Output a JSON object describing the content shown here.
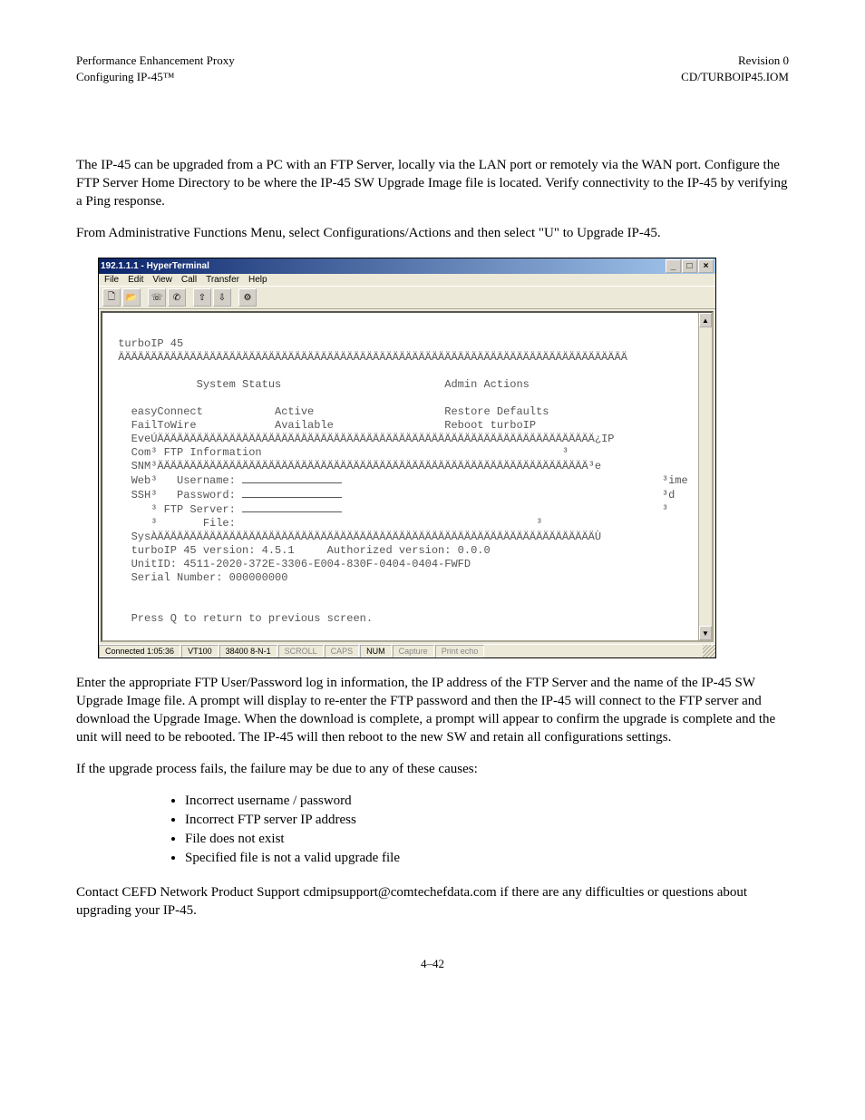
{
  "doc": {
    "header_left_1": "Performance Enhancement Proxy",
    "header_left_2": "Configuring        IP-45™",
    "header_right_1": "Revision 0",
    "header_right_2": "CD/TURBOIP45.IOM",
    "p1": "The        IP-45 can be upgraded from a PC with an FTP Server, locally via the LAN port or remotely via the WAN port. Configure the FTP Server Home Directory to be where the        IP-45 SW Upgrade Image file is located. Verify connectivity to the        IP-45 by verifying a Ping response.",
    "p2": "From Administrative Functions Menu, select Configurations/Actions and then select \"U\" to Upgrade        IP-45.",
    "p3": "Enter the appropriate FTP User/Password log in information, the IP address of the FTP Server and the name of the        IP-45 SW Upgrade Image file. A prompt will display to re-enter the FTP password and then the        IP-45 will connect to the FTP server and download the Upgrade Image. When the download is complete, a prompt will appear to confirm the upgrade is complete and the unit will need to be rebooted. The        IP-45 will then reboot to the new SW and retain all configurations settings.",
    "p4": "If the upgrade process fails, the failure may be due to any of these causes:",
    "bullets": [
      "Incorrect username / password",
      "Incorrect FTP server IP address",
      "File does not exist",
      "Specified file is not a valid upgrade file"
    ],
    "p5": "Contact CEFD Network Product Support cdmipsupport@comtechefdata.com  if there are any difficulties or questions about upgrading your        IP-45.",
    "page_num": "4–42"
  },
  "hyperterm": {
    "title": "192.1.1.1 - HyperTerminal",
    "menus": [
      "File",
      "Edit",
      "View",
      "Call",
      "Transfer",
      "Help"
    ],
    "toolbar_icons": [
      "new-icon",
      "open-icon",
      "call-icon",
      "hangup-icon",
      "send-icon",
      "receive-icon",
      "properties-icon"
    ],
    "win_btns": {
      "min": "_",
      "max": "□",
      "close": "×"
    },
    "scroll": {
      "up": "▲",
      "down": "▼"
    },
    "status": {
      "connected": "Connected 1:05:36",
      "term": "VT100",
      "baud": "38400 8-N-1",
      "scroll": "SCROLL",
      "caps": "CAPS",
      "num": "NUM",
      "capture": "Capture",
      "printecho": "Print echo"
    },
    "term_lines": {
      "l0": "",
      "l1": " turboIP 45",
      "l2": " ÄÄÄÄÄÄÄÄÄÄÄÄÄÄÄÄÄÄÄÄÄÄÄÄÄÄÄÄÄÄÄÄÄÄÄÄÄÄÄÄÄÄÄÄÄÄÄÄÄÄÄÄÄÄÄÄÄÄÄÄÄÄÄÄÄÄÄÄÄÄÄÄÄÄÄÄÄÄ",
      "l3": "",
      "l4": "             System Status                         Admin Actions",
      "l5": "",
      "l6": "   easyConnect           Active                    Restore Defaults",
      "l7": "   FailToWire            Available                 Reboot turboIP",
      "l8": "   EveÚÄÄÄÄÄÄÄÄÄÄÄÄÄÄÄÄÄÄÄÄÄÄÄÄÄÄÄÄÄÄÄÄÄÄÄÄÄÄÄÄÄÄÄÄÄÄÄÄÄÄÄÄÄÄÄÄÄÄÄÄÄÄÄÄÄÄÄ¿IP",
      "l9": "   Com³ FTP Information                                              ³",
      "l10": "   SNM³ÄÄÄÄÄÄÄÄÄÄÄÄÄÄÄÄÄÄÄÄÄÄÄÄÄÄÄÄÄÄÄÄÄÄÄÄÄÄÄÄÄÄÄÄÄÄÄÄÄÄÄÄÄÄÄÄÄÄÄÄÄÄÄÄÄÄ³e",
      "l11a": "   Web³   Username: ",
      "l11b": "                                                 ³ime",
      "l12a": "   SSH³   Password: ",
      "l12b": "                                                 ³d",
      "l13a": "      ³ FTP Server: ",
      "l13b": "                                                 ³",
      "l14": "      ³       File:                                              ³",
      "l15": "   SysÀÄÄÄÄÄÄÄÄÄÄÄÄÄÄÄÄÄÄÄÄÄÄÄÄÄÄÄÄÄÄÄÄÄÄÄÄÄÄÄÄÄÄÄÄÄÄÄÄÄÄÄÄÄÄÄÄÄÄÄÄÄÄÄÄÄÄÄÙ",
      "l16": "   turboIP 45 version: 4.5.1     Authorized version: 0.0.0",
      "l17": "   UnitID: 4511-2020-372E-3306-E004-830F-0404-0404-FWFD",
      "l18": "   Serial Number: 000000000",
      "l19": "",
      "l20": "",
      "l21": "   Press Q to return to previous screen.",
      "l22": ""
    }
  }
}
